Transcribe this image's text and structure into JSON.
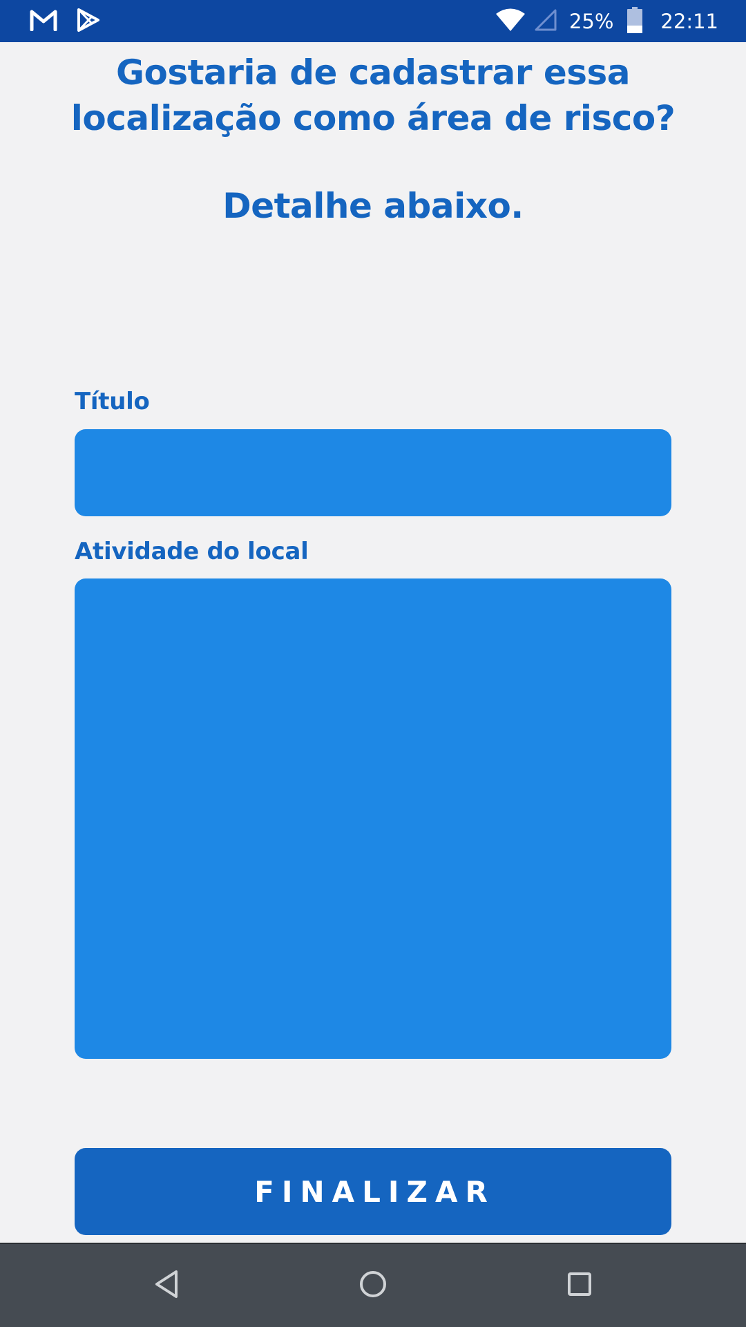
{
  "status_bar": {
    "left_icons": [
      "gmail-icon",
      "play-store-icon"
    ],
    "right_icons": [
      "wifi-icon",
      "cell-signal-icon",
      "battery-icon"
    ],
    "battery_percent": "25%",
    "time": "22:11"
  },
  "headings": {
    "main": "Gostaria de cadastrar essa localização como área de risco?",
    "sub": "Detalhe abaixo."
  },
  "form": {
    "title_label": "Título",
    "title_value": "",
    "activity_label": "Atividade do local",
    "activity_value": "",
    "finalize_label": "FINALIZAR"
  },
  "nav_bar": {
    "icons": [
      "back-icon",
      "home-icon",
      "recents-icon"
    ]
  },
  "colors": {
    "status_bar": "#0d47a1",
    "heading_text": "#1565c0",
    "input_background": "#1e88e5",
    "button_background": "#1565c0",
    "page_background": "#f2f2f3",
    "nav_bar": "#454b52"
  }
}
